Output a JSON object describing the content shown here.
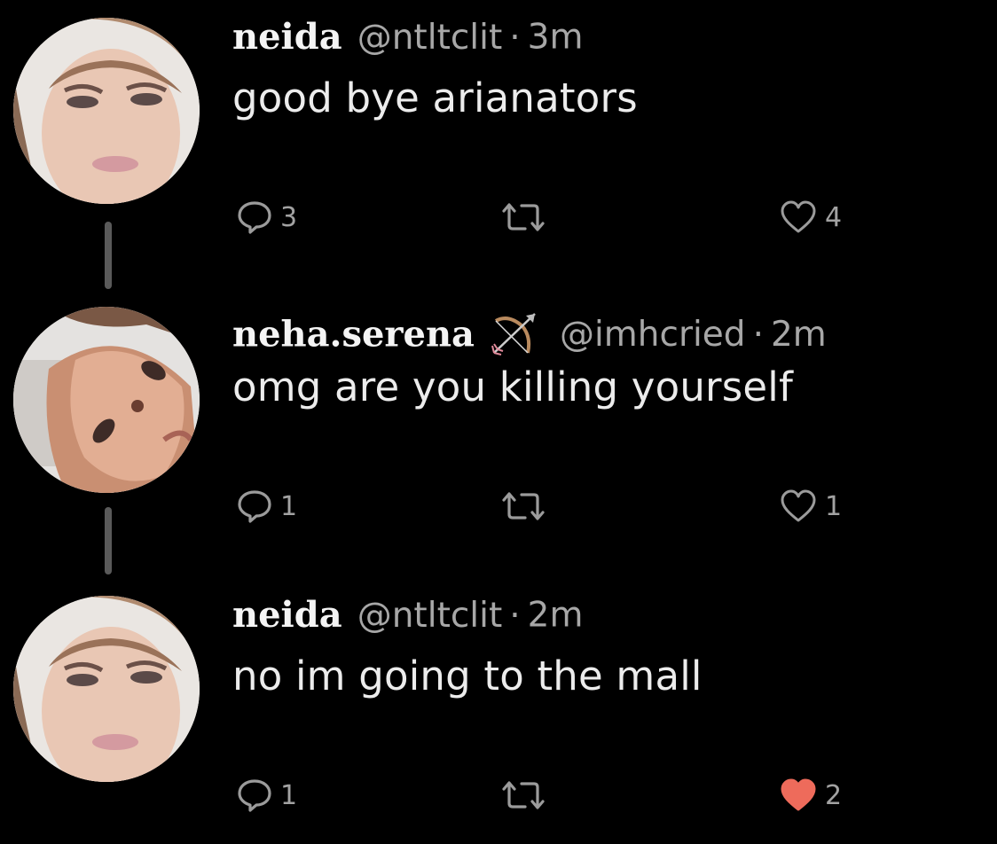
{
  "tweets": [
    {
      "name": "neida",
      "handle": "@ntltclit",
      "separator": "·",
      "time": "3m",
      "text": "good bye arianators",
      "reply_count": "3",
      "retweet_count": "",
      "like_count": "4",
      "liked": false,
      "name_emoji": ""
    },
    {
      "name": "neha.serena",
      "handle": "@imhcried",
      "separator": "·",
      "time": "2m",
      "text": "omg are you killing yourself",
      "reply_count": "1",
      "retweet_count": "",
      "like_count": "1",
      "liked": false,
      "name_emoji": "bow-and-arrow-icon"
    },
    {
      "name": "neida",
      "handle": "@ntltclit",
      "separator": "·",
      "time": "2m",
      "text": "no im going to the mall",
      "reply_count": "1",
      "retweet_count": "",
      "like_count": "2",
      "liked": true,
      "name_emoji": ""
    }
  ],
  "colors": {
    "background": "#000000",
    "text": "#ececec",
    "muted": "#a7a7a7",
    "thread_line": "#5a5a5a",
    "liked_heart": "#ee6b5b"
  }
}
